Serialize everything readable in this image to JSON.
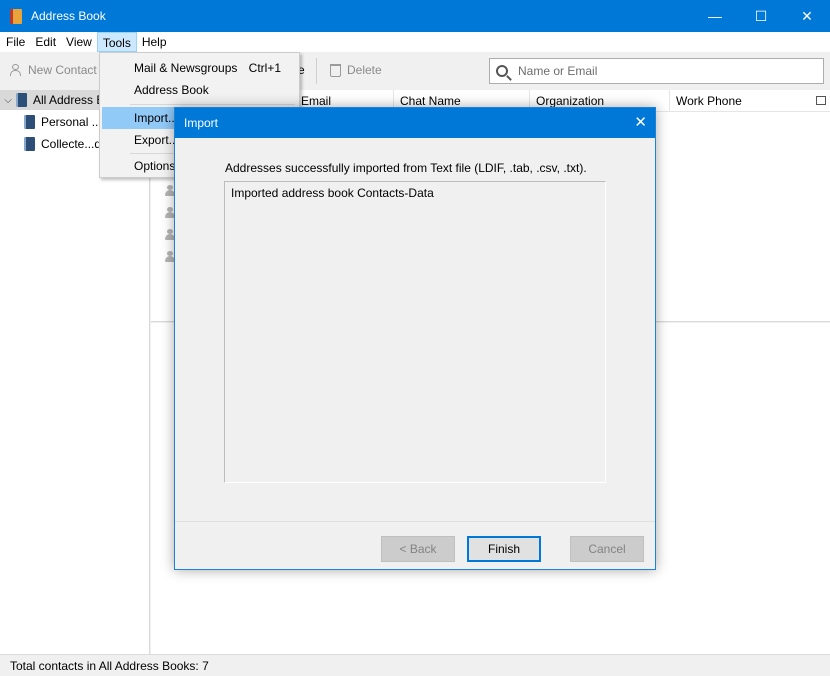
{
  "window": {
    "title": "Address Book",
    "controls": {
      "minimize": "—",
      "maximize": "☐",
      "close": "✕"
    }
  },
  "menubar": {
    "items": [
      {
        "label": "File"
      },
      {
        "label": "Edit"
      },
      {
        "label": "View"
      },
      {
        "label": "Tools"
      },
      {
        "label": "Help"
      }
    ]
  },
  "toolbar": {
    "new_contact": "New Contact",
    "edit_partial": "e",
    "delete": "Delete",
    "search_placeholder": "Name or Email"
  },
  "sidebar": {
    "items": [
      {
        "label": "All Address B"
      },
      {
        "label": "Personal ..."
      },
      {
        "label": "Collecte...d"
      }
    ]
  },
  "list": {
    "columns": [
      {
        "label": "Email"
      },
      {
        "label": "Chat Name"
      },
      {
        "label": "Organization"
      },
      {
        "label": "Work Phone"
      }
    ]
  },
  "tools_menu": {
    "items": [
      {
        "label": "Mail & Newsgroups",
        "shortcut": "Ctrl+1"
      },
      {
        "label": "Address Book"
      },
      {
        "label": "Import..."
      },
      {
        "label": "Export..."
      },
      {
        "label": "Options"
      }
    ]
  },
  "import_dialog": {
    "title": "Import",
    "close": "✕",
    "message": "Addresses successfully imported from Text file (LDIF, .tab, .csv, .txt).",
    "log": "Imported address book Contacts-Data",
    "buttons": {
      "back": "< Back",
      "finish": "Finish",
      "cancel": "Cancel"
    }
  },
  "statusbar": {
    "text": "Total contacts in All Address Books: 7"
  }
}
